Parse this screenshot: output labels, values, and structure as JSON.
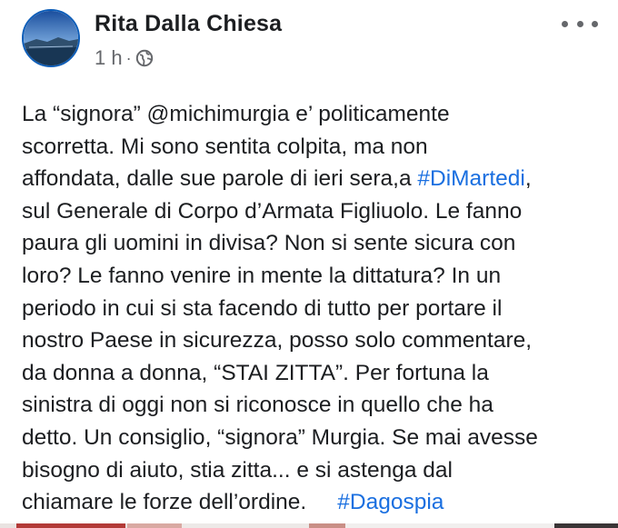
{
  "header": {
    "author_name": "Rita Dalla Chiesa",
    "timestamp": "1 h",
    "separator": "·",
    "audience_icon": "globe-icon",
    "more_icon": "more-options-icon"
  },
  "post": {
    "lines": [
      {
        "text": "La “signora” @michimurgia e’ politicamente"
      },
      {
        "text": "scorretta. Mi sono sentita colpita, ma non"
      },
      {
        "text": "affondata, dalle sue parole di ieri sera,a ",
        "hashtag": "#DiMartedi",
        "after": ","
      },
      {
        "text": "sul Generale di Corpo d’Armata Figliuolo. Le fanno"
      },
      {
        "text": "paura gli uomini in divisa? Non si sente sicura con"
      },
      {
        "text": "loro? Le fanno venire in mente la dittatura? In un"
      },
      {
        "text": "periodo in cui si sta facendo di tutto per portare il"
      },
      {
        "text": "nostro Paese in sicurezza, posso solo commentare,"
      },
      {
        "text": "da donna a donna, “STAI ZITTA”. Per fortuna la"
      },
      {
        "text": "sinistra di oggi non si riconosce in quello che ha"
      },
      {
        "text": "detto. Un consiglio, “signora” Murgia. Se mai avesse"
      },
      {
        "text": "bisogno di aiuto, stia zitta... e si astenga dal"
      },
      {
        "text": "chiamare le forze dell’ordine.     ",
        "hashtag": "#Dagospia",
        "after": ""
      }
    ]
  },
  "colors": {
    "text": "#1c1e21",
    "secondary": "#65676b",
    "hashtag": "#1a6fe0",
    "avatar_border": "#0d5db8"
  }
}
